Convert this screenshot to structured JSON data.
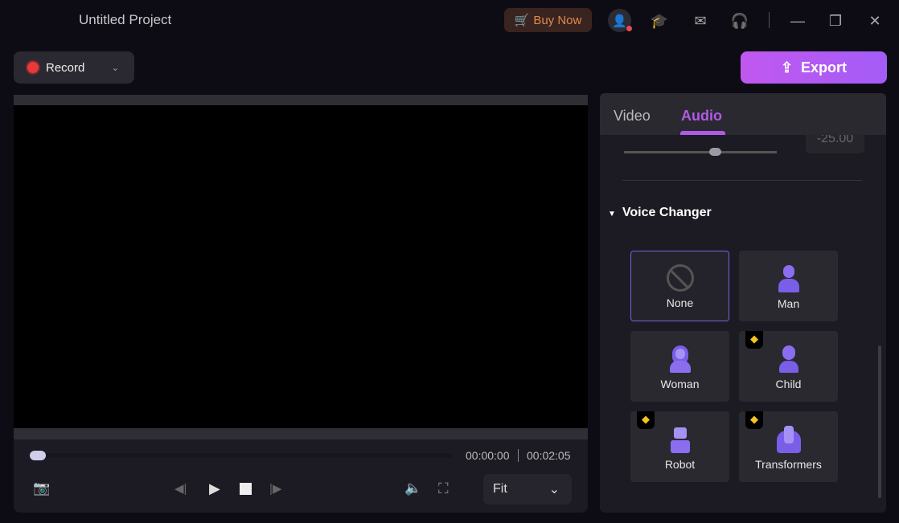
{
  "app": {
    "title": "Untitled Project"
  },
  "header": {
    "buy_label": "Buy Now",
    "icons": [
      "cart-icon",
      "user-icon",
      "graduation-cap-icon",
      "mail-icon",
      "headset-icon",
      "minimize-icon",
      "restore-icon",
      "close-icon"
    ]
  },
  "toolbar": {
    "record_label": "Record",
    "export_label": "Export"
  },
  "player": {
    "current_time": "00:00:00",
    "total_time": "00:02:05",
    "zoom_select": "Fit",
    "progress": 0
  },
  "panel": {
    "tabs": [
      {
        "label": "Video",
        "active": false
      },
      {
        "label": "Audio",
        "active": true
      }
    ],
    "slider_value": "-25.00",
    "section_title": "Voice Changer",
    "voices": [
      {
        "label": "None",
        "premium": false,
        "selected": true
      },
      {
        "label": "Man",
        "premium": false
      },
      {
        "label": "Woman",
        "premium": false
      },
      {
        "label": "Child",
        "premium": true
      },
      {
        "label": "Robot",
        "premium": true
      },
      {
        "label": "Transformers",
        "premium": true
      }
    ]
  },
  "colors": {
    "accent": "#b15ae8",
    "export_gradient_start": "#c158f0",
    "export_gradient_end": "#a45cf7",
    "record": "#e83a3a",
    "premium": "#f5c518"
  }
}
